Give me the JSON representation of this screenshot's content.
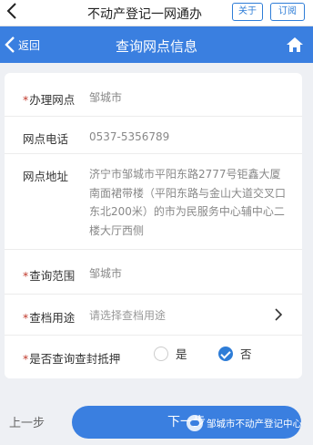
{
  "appbar": {
    "back_icon": "chevron-left-icon",
    "title": "不动产登记一网通办",
    "about_label": "关于",
    "subscribe_label": "订阅"
  },
  "navbar": {
    "back_label": "返回",
    "title": "查询网点信息",
    "home_icon": "home-icon",
    "color": "#3a7fe0"
  },
  "form": {
    "office": {
      "label": "办理网点",
      "required": true,
      "value": "邹城市"
    },
    "phone": {
      "label": "网点电话",
      "value": "0537-5356789"
    },
    "address": {
      "label": "网点地址",
      "value": "济宁市邹城市平阳东路2777号钜鑫大厦南面裙带楼（平阳东路与金山大道交叉口东北200米）的市为民服务中心辅中心二楼大厅西侧"
    },
    "scope": {
      "label": "查询范围",
      "required": true,
      "value": "邹城市"
    },
    "purpose": {
      "label": "查档用途",
      "required": true,
      "placeholder": "请选择查档用途"
    },
    "seal": {
      "label": "是否查询查封抵押",
      "required": true,
      "options": [
        {
          "label": "是",
          "checked": false
        },
        {
          "label": "否",
          "checked": true
        }
      ]
    }
  },
  "footer": {
    "prev_label": "上一步",
    "next_label": "下一步",
    "watermark": "邹城市不动产登记中心"
  },
  "required_mark": "*"
}
